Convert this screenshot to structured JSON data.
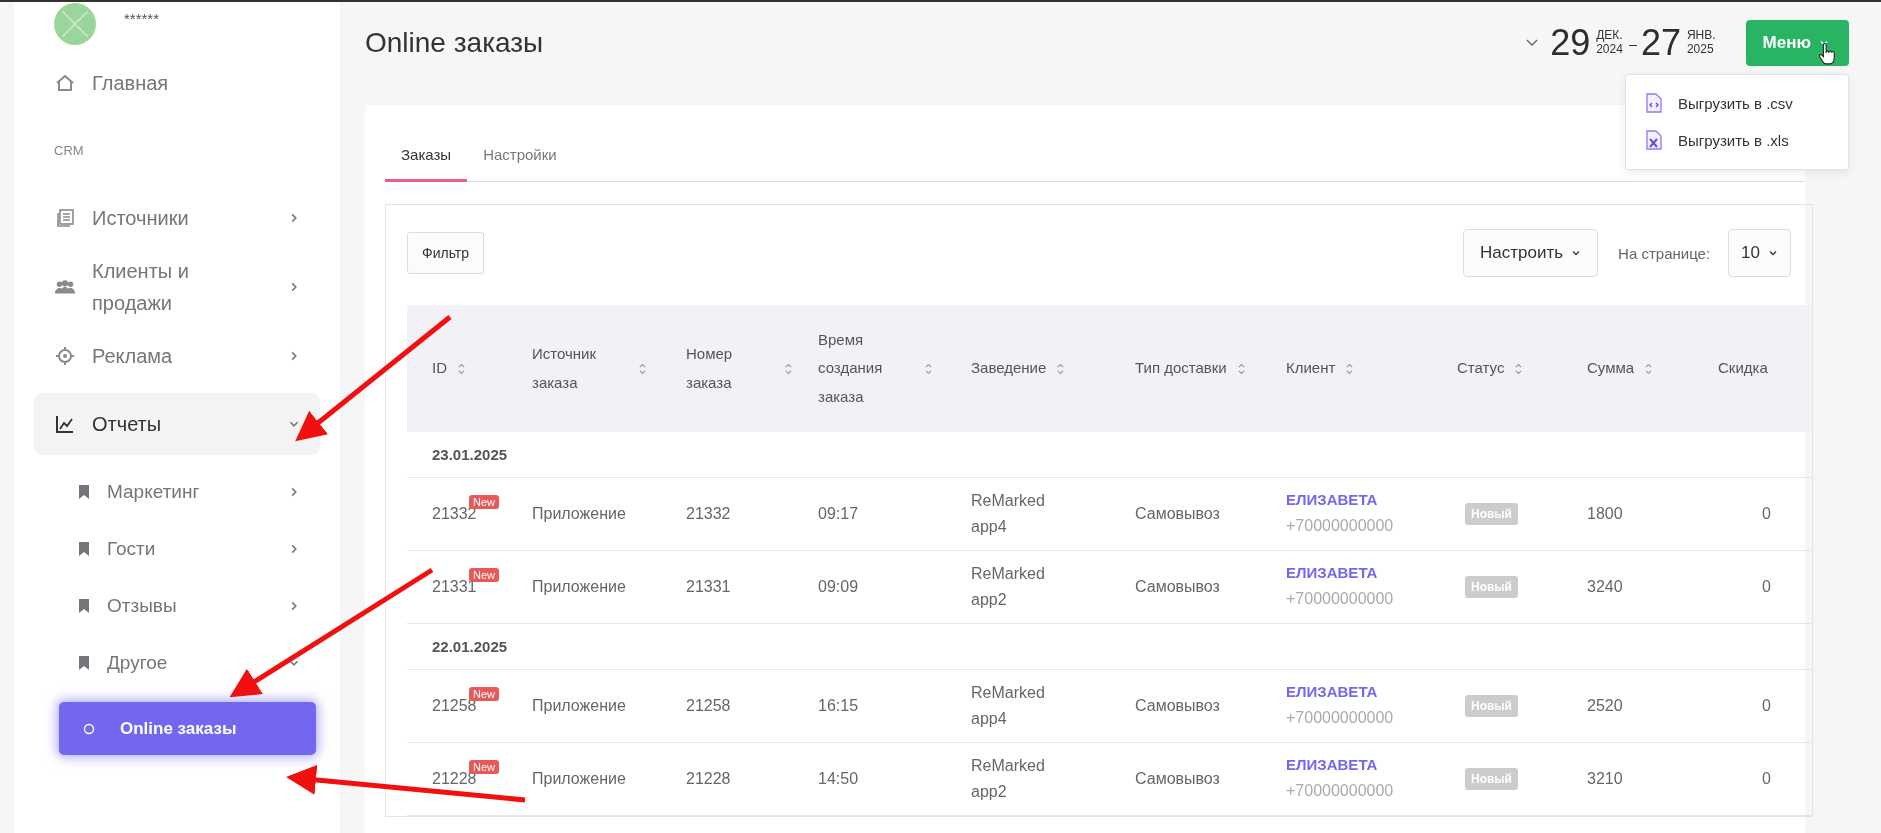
{
  "sidebar": {
    "user": {
      "name": "******"
    },
    "nav": [
      {
        "kind": "item",
        "label": "Главная"
      },
      {
        "kind": "section",
        "label": "CRM"
      },
      {
        "kind": "item",
        "label": "Источники",
        "expanded": false
      },
      {
        "kind": "item",
        "label": "Клиенты и продажи",
        "expanded": false
      },
      {
        "kind": "item",
        "label": "Реклама",
        "expanded": false
      },
      {
        "kind": "item",
        "label": "Отчеты",
        "expanded": true,
        "selected": true,
        "children": [
          {
            "label": "Маркетинг",
            "expanded": false
          },
          {
            "label": "Гости",
            "expanded": false
          },
          {
            "label": "Отзывы",
            "expanded": false
          },
          {
            "label": "Другое",
            "expanded": true,
            "children": [
              {
                "label": "Online заказы",
                "selected": true
              }
            ]
          }
        ]
      }
    ]
  },
  "header": {
    "title": "Online заказы",
    "date_range": {
      "from_day": "29",
      "from_month": "ДЕК.",
      "from_year": "2024",
      "to_day": "27",
      "to_month": "ЯНВ.",
      "to_year": "2025"
    },
    "menu_button": "Меню",
    "menu_items": [
      {
        "label": "Выгрузить в .csv"
      },
      {
        "label": "Выгрузить в .xls"
      }
    ]
  },
  "tabs": [
    {
      "label": "Заказы",
      "selected": true
    },
    {
      "label": "Настройки",
      "selected": false
    }
  ],
  "toolbar": {
    "filter": "Фильтр",
    "configure": "Настроить",
    "per_page_label": "На странице:",
    "per_page": "10"
  },
  "table": {
    "columns": [
      "ID",
      "Источник заказа",
      "Номер заказа",
      "Время создания заказа",
      "Заведение",
      "Тип доставки",
      "Клиент",
      "Статус",
      "Сумма",
      "Скидка"
    ],
    "groups": [
      {
        "date": "23.01.2025",
        "rows": [
          {
            "id": "21332",
            "badge": "New",
            "source": "Приложение",
            "number": "21332",
            "time": "09:17",
            "venue": "ReMarked app4",
            "delivery": "Самовывоз",
            "client": "ЕЛИЗАВЕТА",
            "phone": "+70000000000",
            "status": "Новый",
            "sum": "1800",
            "discount": "0"
          },
          {
            "id": "21331",
            "badge": "New",
            "source": "Приложение",
            "number": "21331",
            "time": "09:09",
            "venue": "ReMarked app2",
            "delivery": "Самовывоз",
            "client": "ЕЛИЗАВЕТА",
            "phone": "+70000000000",
            "status": "Новый",
            "sum": "3240",
            "discount": "0"
          }
        ]
      },
      {
        "date": "22.01.2025",
        "rows": [
          {
            "id": "21258",
            "badge": "New",
            "source": "Приложение",
            "number": "21258",
            "time": "16:15",
            "venue": "ReMarked app4",
            "delivery": "Самовывоз",
            "client": "ЕЛИЗАВЕТА",
            "phone": "+70000000000",
            "status": "Новый",
            "sum": "2520",
            "discount": "0"
          },
          {
            "id": "21228",
            "badge": "New",
            "source": "Приложение",
            "number": "21228",
            "time": "14:50",
            "venue": "ReMarked app2",
            "delivery": "Самовывоз",
            "client": "ЕЛИЗАВЕТА",
            "phone": "+70000000000",
            "status": "Новый",
            "sum": "3210",
            "discount": "0"
          }
        ]
      }
    ]
  }
}
